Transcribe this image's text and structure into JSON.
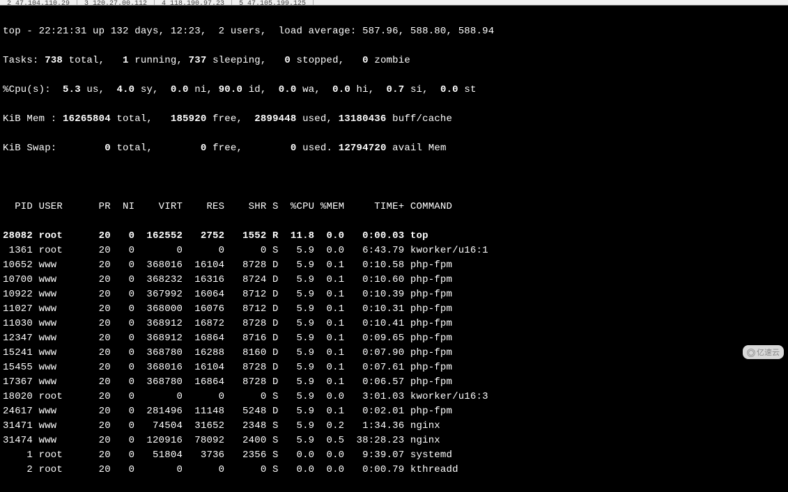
{
  "tabs": [
    "2 47.104.110.29",
    "3 120.27.00.112",
    "4 118.190.97.23",
    "5 47.105.199.125"
  ],
  "summary": {
    "line1_prefix": "top - 22:21:31 up 132 days, 12:23,  2 users,  load average: 587.96, 588.80, 588.94",
    "tasks_label": "Tasks: ",
    "tasks_total": "738",
    "tasks_total_lbl": " total,   ",
    "tasks_running": "1",
    "tasks_running_lbl": " running, ",
    "tasks_sleeping": "737",
    "tasks_sleeping_lbl": " sleeping,   ",
    "tasks_stopped": "0",
    "tasks_stopped_lbl": " stopped,   ",
    "tasks_zombie": "0",
    "tasks_zombie_lbl": " zombie",
    "cpu_label": "%Cpu(s):  ",
    "cpu_us": "5.3",
    "cpu_us_lbl": " us,  ",
    "cpu_sy": "4.0",
    "cpu_sy_lbl": " sy,  ",
    "cpu_ni": "0.0",
    "cpu_ni_lbl": " ni, ",
    "cpu_id": "90.0",
    "cpu_id_lbl": " id,  ",
    "cpu_wa": "0.0",
    "cpu_wa_lbl": " wa,  ",
    "cpu_hi": "0.0",
    "cpu_hi_lbl": " hi,  ",
    "cpu_si": "0.7",
    "cpu_si_lbl": " si,  ",
    "cpu_st": "0.0",
    "cpu_st_lbl": " st",
    "mem_label": "KiB Mem : ",
    "mem_total": "16265804",
    "mem_total_lbl": " total,   ",
    "mem_free": "185920",
    "mem_free_lbl": " free,  ",
    "mem_used": "2899448",
    "mem_used_lbl": " used, ",
    "mem_buff": "13180436",
    "mem_buff_lbl": " buff/cache",
    "swap_label": "KiB Swap:        ",
    "swap_total": "0",
    "swap_total_lbl": " total,        ",
    "swap_free": "0",
    "swap_free_lbl": " free,        ",
    "swap_used": "0",
    "swap_used_lbl": " used. ",
    "swap_avail": "12794720",
    "swap_avail_lbl": " avail Mem"
  },
  "columns": "  PID USER      PR  NI    VIRT    RES    SHR S  %CPU %MEM     TIME+ COMMAND",
  "processes": [
    {
      "pid": "28082",
      "user": "root",
      "pr": "20",
      "ni": "0",
      "virt": "162552",
      "res": "2752",
      "shr": "1552",
      "s": "R",
      "cpu": "11.8",
      "mem": "0.0",
      "time": "0:00.03",
      "cmd": "top",
      "bold": true
    },
    {
      "pid": "1361",
      "user": "root",
      "pr": "20",
      "ni": "0",
      "virt": "0",
      "res": "0",
      "shr": "0",
      "s": "S",
      "cpu": "5.9",
      "mem": "0.0",
      "time": "6:43.79",
      "cmd": "kworker/u16:1"
    },
    {
      "pid": "10652",
      "user": "www",
      "pr": "20",
      "ni": "0",
      "virt": "368016",
      "res": "16104",
      "shr": "8728",
      "s": "D",
      "cpu": "5.9",
      "mem": "0.1",
      "time": "0:10.58",
      "cmd": "php-fpm"
    },
    {
      "pid": "10700",
      "user": "www",
      "pr": "20",
      "ni": "0",
      "virt": "368232",
      "res": "16316",
      "shr": "8724",
      "s": "D",
      "cpu": "5.9",
      "mem": "0.1",
      "time": "0:10.60",
      "cmd": "php-fpm"
    },
    {
      "pid": "10922",
      "user": "www",
      "pr": "20",
      "ni": "0",
      "virt": "367992",
      "res": "16064",
      "shr": "8712",
      "s": "D",
      "cpu": "5.9",
      "mem": "0.1",
      "time": "0:10.39",
      "cmd": "php-fpm"
    },
    {
      "pid": "11027",
      "user": "www",
      "pr": "20",
      "ni": "0",
      "virt": "368000",
      "res": "16076",
      "shr": "8712",
      "s": "D",
      "cpu": "5.9",
      "mem": "0.1",
      "time": "0:10.31",
      "cmd": "php-fpm"
    },
    {
      "pid": "11030",
      "user": "www",
      "pr": "20",
      "ni": "0",
      "virt": "368912",
      "res": "16872",
      "shr": "8728",
      "s": "D",
      "cpu": "5.9",
      "mem": "0.1",
      "time": "0:10.41",
      "cmd": "php-fpm"
    },
    {
      "pid": "12347",
      "user": "www",
      "pr": "20",
      "ni": "0",
      "virt": "368912",
      "res": "16864",
      "shr": "8716",
      "s": "D",
      "cpu": "5.9",
      "mem": "0.1",
      "time": "0:09.65",
      "cmd": "php-fpm"
    },
    {
      "pid": "15241",
      "user": "www",
      "pr": "20",
      "ni": "0",
      "virt": "368780",
      "res": "16288",
      "shr": "8160",
      "s": "D",
      "cpu": "5.9",
      "mem": "0.1",
      "time": "0:07.90",
      "cmd": "php-fpm"
    },
    {
      "pid": "15455",
      "user": "www",
      "pr": "20",
      "ni": "0",
      "virt": "368016",
      "res": "16104",
      "shr": "8728",
      "s": "D",
      "cpu": "5.9",
      "mem": "0.1",
      "time": "0:07.61",
      "cmd": "php-fpm"
    },
    {
      "pid": "17367",
      "user": "www",
      "pr": "20",
      "ni": "0",
      "virt": "368780",
      "res": "16864",
      "shr": "8728",
      "s": "D",
      "cpu": "5.9",
      "mem": "0.1",
      "time": "0:06.57",
      "cmd": "php-fpm"
    },
    {
      "pid": "18020",
      "user": "root",
      "pr": "20",
      "ni": "0",
      "virt": "0",
      "res": "0",
      "shr": "0",
      "s": "S",
      "cpu": "5.9",
      "mem": "0.0",
      "time": "3:01.03",
      "cmd": "kworker/u16:3"
    },
    {
      "pid": "24617",
      "user": "www",
      "pr": "20",
      "ni": "0",
      "virt": "281496",
      "res": "11148",
      "shr": "5248",
      "s": "D",
      "cpu": "5.9",
      "mem": "0.1",
      "time": "0:02.01",
      "cmd": "php-fpm"
    },
    {
      "pid": "31471",
      "user": "www",
      "pr": "20",
      "ni": "0",
      "virt": "74504",
      "res": "31652",
      "shr": "2348",
      "s": "S",
      "cpu": "5.9",
      "mem": "0.2",
      "time": "1:34.36",
      "cmd": "nginx"
    },
    {
      "pid": "31474",
      "user": "www",
      "pr": "20",
      "ni": "0",
      "virt": "120916",
      "res": "78092",
      "shr": "2400",
      "s": "S",
      "cpu": "5.9",
      "mem": "0.5",
      "time": "38:28.23",
      "cmd": "nginx"
    },
    {
      "pid": "1",
      "user": "root",
      "pr": "20",
      "ni": "0",
      "virt": "51804",
      "res": "3736",
      "shr": "2356",
      "s": "S",
      "cpu": "0.0",
      "mem": "0.0",
      "time": "9:39.07",
      "cmd": "systemd"
    },
    {
      "pid": "2",
      "user": "root",
      "pr": "20",
      "ni": "0",
      "virt": "0",
      "res": "0",
      "shr": "0",
      "s": "S",
      "cpu": "0.0",
      "mem": "0.0",
      "time": "0:00.79",
      "cmd": "kthreadd"
    }
  ],
  "watermark": "亿速云"
}
